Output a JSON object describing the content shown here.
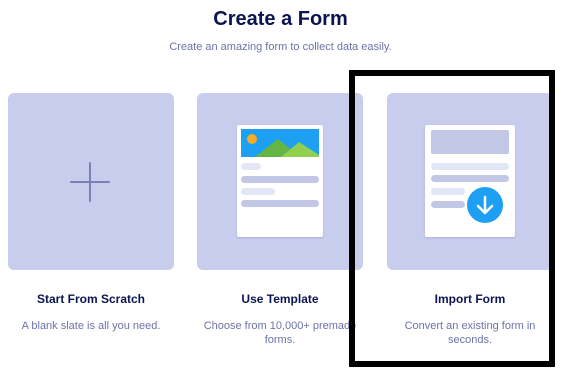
{
  "header": {
    "title": "Create a Form",
    "subtitle": "Create an amazing form to collect data easily."
  },
  "options": [
    {
      "label": "Start From Scratch",
      "description": "A blank slate is all you need.",
      "icon": "plus-icon"
    },
    {
      "label": "Use Template",
      "description": "Choose from 10,000+ premade forms.",
      "icon": "template-document-icon"
    },
    {
      "label": "Import Form",
      "description": "Convert an existing form in seconds.",
      "icon": "import-document-icon"
    }
  ],
  "colors": {
    "title": "#0a1551",
    "text_muted": "#6c73a8",
    "card_background": "#c8cdee",
    "accent_blue": "#1d9ff3",
    "highlight_frame": "#000000"
  }
}
